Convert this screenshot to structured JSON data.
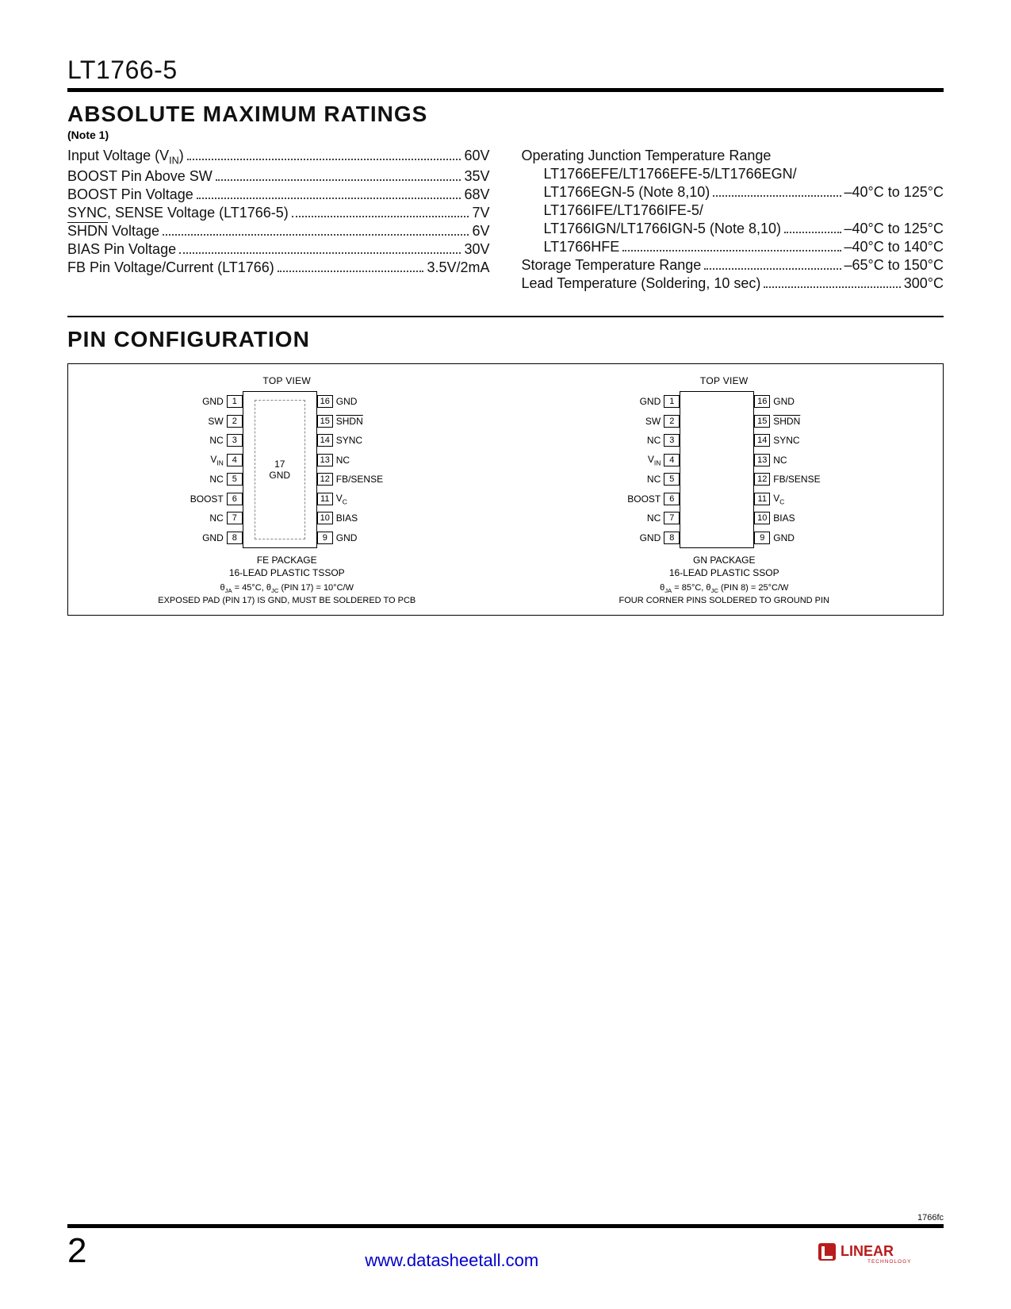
{
  "part_number": "LT1766-5",
  "sections": {
    "ratings_title": "ABSOLUTE MAXIMUM RATINGS",
    "ratings_note": "(Note 1)",
    "pin_title": "PIN CONFIGURATION"
  },
  "ratings_left": [
    {
      "label": "Input Voltage (V<sub>IN</sub>)",
      "val": "60V"
    },
    {
      "label": "BOOST Pin Above SW",
      "val": "35V"
    },
    {
      "label": "BOOST Pin Voltage",
      "val": "68V"
    },
    {
      "label": "SYNC, SENSE Voltage (LT1766-5)",
      "val": "7V"
    },
    {
      "label": "<span class='overline'>SHDN</span> Voltage",
      "val": "6V"
    },
    {
      "label": "BIAS Pin Voltage",
      "val": "30V"
    },
    {
      "label": "FB Pin Voltage/Current (LT1766)",
      "val": "3.5V/2mA"
    }
  ],
  "ratings_right": [
    {
      "label": "Operating Junction Temperature Range",
      "val": "",
      "nodots": true
    },
    {
      "label": "LT1766EFE/LT1766EFE-5/LT1766EGN/",
      "val": "",
      "indent": true,
      "nodots": true
    },
    {
      "label": "LT1766EGN-5 (Note 8,10)",
      "val": "–40°C to 125°C",
      "indent": true
    },
    {
      "label": "LT1766IFE/LT1766IFE-5/",
      "val": "",
      "indent": true,
      "nodots": true
    },
    {
      "label": "LT1766IGN/LT1766IGN-5 (Note 8,10)",
      "val": "–40°C to 125°C",
      "indent": true
    },
    {
      "label": "LT1766HFE",
      "val": "–40°C to 140°C",
      "indent": true
    },
    {
      "label": "Storage Temperature Range",
      "val": "–65°C to 150°C"
    },
    {
      "label": "Lead Temperature (Soldering, 10 sec)",
      "val": "300°C"
    }
  ],
  "pin_common": {
    "top_view": "TOP VIEW",
    "left_pins": [
      {
        "n": "1",
        "name": "GND"
      },
      {
        "n": "2",
        "name": "SW"
      },
      {
        "n": "3",
        "name": "NC"
      },
      {
        "n": "4",
        "name": "V<sub>IN</sub>"
      },
      {
        "n": "5",
        "name": "NC"
      },
      {
        "n": "6",
        "name": "BOOST"
      },
      {
        "n": "7",
        "name": "NC"
      },
      {
        "n": "8",
        "name": "GND"
      }
    ],
    "right_pins": [
      {
        "n": "16",
        "name": "GND"
      },
      {
        "n": "15",
        "name": "<span class='overline'>SHDN</span>"
      },
      {
        "n": "14",
        "name": "SYNC"
      },
      {
        "n": "13",
        "name": "NC"
      },
      {
        "n": "12",
        "name": "FB/SENSE"
      },
      {
        "n": "11",
        "name": "V<sub>C</sub>"
      },
      {
        "n": "10",
        "name": "BIAS"
      },
      {
        "n": "9",
        "name": "GND"
      }
    ]
  },
  "packages": [
    {
      "inner": "17<br>GND",
      "show_inner_box": true,
      "pkg_name": "FE PACKAGE",
      "pkg_sub": "16-LEAD PLASTIC TSSOP",
      "thermal": "θ<sub>JA</sub> = 45°C, θ<sub>JC</sub> (PIN 17) = 10°C/W",
      "note": "EXPOSED PAD (PIN 17) IS GND, MUST BE SOLDERED TO PCB"
    },
    {
      "inner": "",
      "show_inner_box": false,
      "pkg_name": "GN PACKAGE",
      "pkg_sub": "16-LEAD PLASTIC SSOP",
      "thermal": "θ<sub>JA</sub> = 85°C, θ<sub>JC</sub> (PIN 8) = 25°C/W",
      "note": "FOUR CORNER PINS SOLDERED TO GROUND PIN"
    }
  ],
  "footer": {
    "doc_code": "1766fc",
    "page_num": "2",
    "url": "www.datasheetall.com",
    "logo_brand": "LINEAR",
    "logo_sub": "TECHNOLOGY"
  }
}
